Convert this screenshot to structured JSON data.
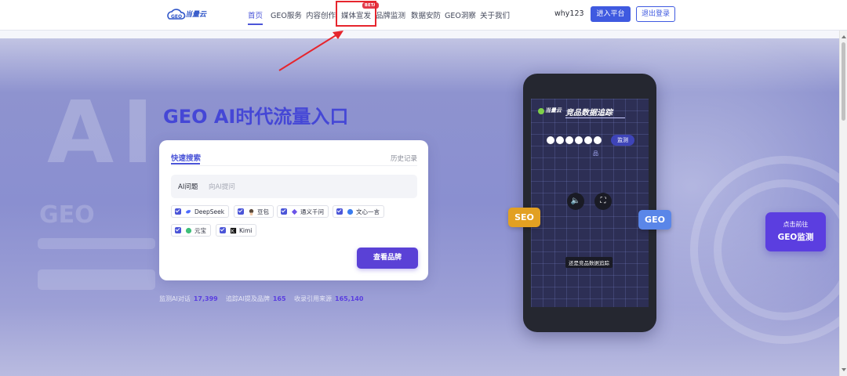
{
  "header": {
    "logo": {
      "text": "当量云"
    },
    "nav": [
      {
        "label": "首页",
        "active": true
      },
      {
        "label": "GEO服务"
      },
      {
        "label": "内容创作"
      },
      {
        "label": "媒体宣发",
        "badge": "BETA"
      },
      {
        "label": "品牌监测"
      },
      {
        "label": "数据安防"
      },
      {
        "label": "GEO洞察"
      },
      {
        "label": "关于我们"
      }
    ],
    "username": "why123",
    "enter_label": "进入平台",
    "logout_label": "退出登录"
  },
  "hero": {
    "title": "GEO AI时代流量入口",
    "search_card": {
      "tab_quick": "快速搜索",
      "tab_history": "历史记录",
      "query_type": "AI问题",
      "query_placeholder": "向AI提问",
      "platforms": [
        {
          "label": "DeepSeek",
          "checked": true,
          "icon": "deepseek-icon"
        },
        {
          "label": "豆包",
          "checked": true,
          "icon": "doubao-icon"
        },
        {
          "label": "通义千问",
          "checked": true,
          "icon": "tongyi-icon"
        },
        {
          "label": "文心一言",
          "checked": true,
          "icon": "wenxin-icon"
        },
        {
          "label": "元宝",
          "checked": true,
          "icon": "yuanbao-icon"
        },
        {
          "label": "Kimi",
          "checked": true,
          "icon": "kimi-icon"
        }
      ],
      "submit_label": "查看品牌"
    },
    "stats": [
      {
        "label": "监测AI对话",
        "value": "17,399"
      },
      {
        "label": "追踪AI提及品牌",
        "value": "165"
      },
      {
        "label": "收录引用来源",
        "value": "165,140"
      }
    ],
    "phone": {
      "brand": "当量云",
      "title": "竞品数据追踪",
      "monitor_label": "监测",
      "sub_label": "品",
      "caption": "还是竞品数据追踪"
    },
    "seo_label": "SEO",
    "geo_label": "GEO",
    "cta": {
      "line1": "点击前往",
      "line2": "GEO监测"
    }
  },
  "colors": {
    "primary": "#4b55d8",
    "button": "#5a41d6",
    "annotation": "#e6252d",
    "seo": "#e2a022",
    "geo": "#5a86e8"
  }
}
